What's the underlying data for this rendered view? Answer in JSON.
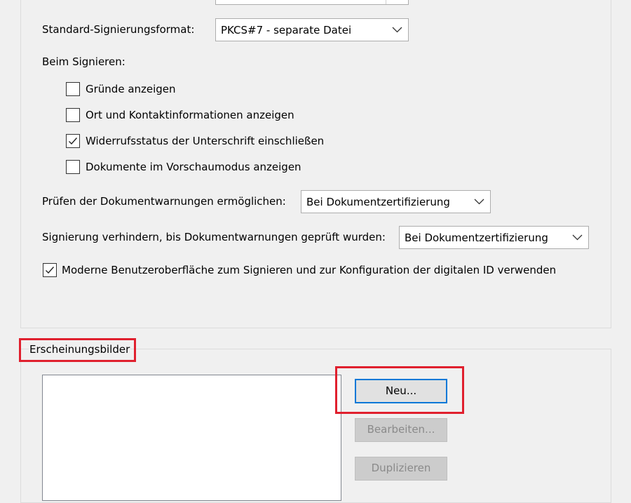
{
  "signing": {
    "format_label": "Standard-Signierungsformat:",
    "format_value": "PKCS#7 - separate Datei",
    "when_signing_label": "Beim Signieren:",
    "options": [
      {
        "label": "Gründe anzeigen",
        "checked": false
      },
      {
        "label": "Ort und Kontaktinformationen anzeigen",
        "checked": false
      },
      {
        "label": "Widerrufsstatus der Unterschrift einschließen",
        "checked": true
      },
      {
        "label": "Dokumente im Vorschaumodus anzeigen",
        "checked": false
      }
    ],
    "check_warnings_label": "Prüfen der Dokumentwarnungen ermöglichen:",
    "check_warnings_value": "Bei Dokumentzertifizierung",
    "prevent_signing_label": "Signierung verhindern, bis Dokumentwarnungen geprüft wurden:",
    "prevent_signing_value": "Bei Dokumentzertifizierung",
    "modern_ui_label": "Moderne Benutzeroberfläche zum Signieren und zur Konfiguration der digitalen ID verwenden",
    "modern_ui_checked": true
  },
  "appearances": {
    "group_label": "Erscheinungsbilder",
    "new_button": "Neu...",
    "edit_button": "Bearbeiten...",
    "duplicate_button": "Duplizieren"
  },
  "colors": {
    "highlight": "#e0202e",
    "focus_border": "#0078d7"
  }
}
